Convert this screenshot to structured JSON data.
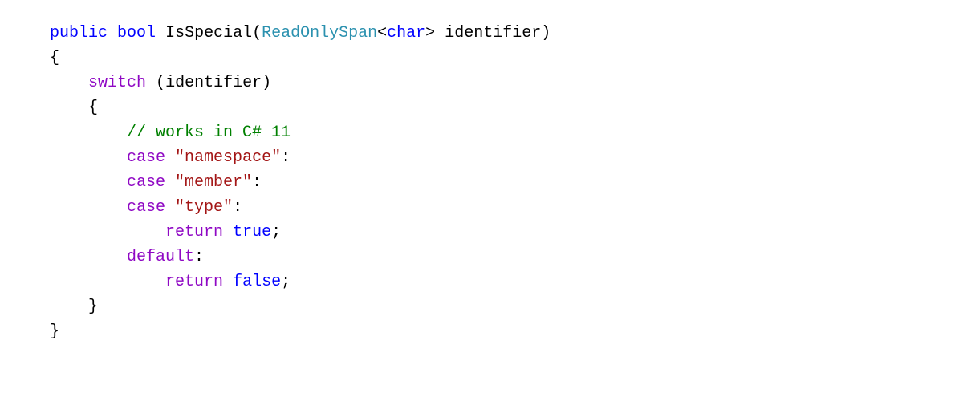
{
  "code": {
    "kw_public": "public",
    "kw_bool": "bool",
    "method_name": "IsSpecial",
    "paren_open": "(",
    "type_readonlyspan": "ReadOnlySpan",
    "angle_open": "<",
    "kw_char": "char",
    "angle_close": ">",
    "param_name": "identifier",
    "paren_close": ")",
    "brace_open": "{",
    "kw_switch": "switch",
    "sw_paren_open": "(",
    "switch_expr": "identifier",
    "sw_paren_close": ")",
    "sw_brace_open": "{",
    "comment": "// works in C# 11",
    "kw_case1": "case",
    "str_namespace": "\"namespace\"",
    "colon1": ":",
    "kw_case2": "case",
    "str_member": "\"member\"",
    "colon2": ":",
    "kw_case3": "case",
    "str_type": "\"type\"",
    "colon3": ":",
    "kw_return1": "return",
    "kw_true": "true",
    "semi1": ";",
    "kw_default": "default",
    "colon4": ":",
    "kw_return2": "return",
    "kw_false": "false",
    "semi2": ";",
    "sw_brace_close": "}",
    "brace_close": "}"
  }
}
